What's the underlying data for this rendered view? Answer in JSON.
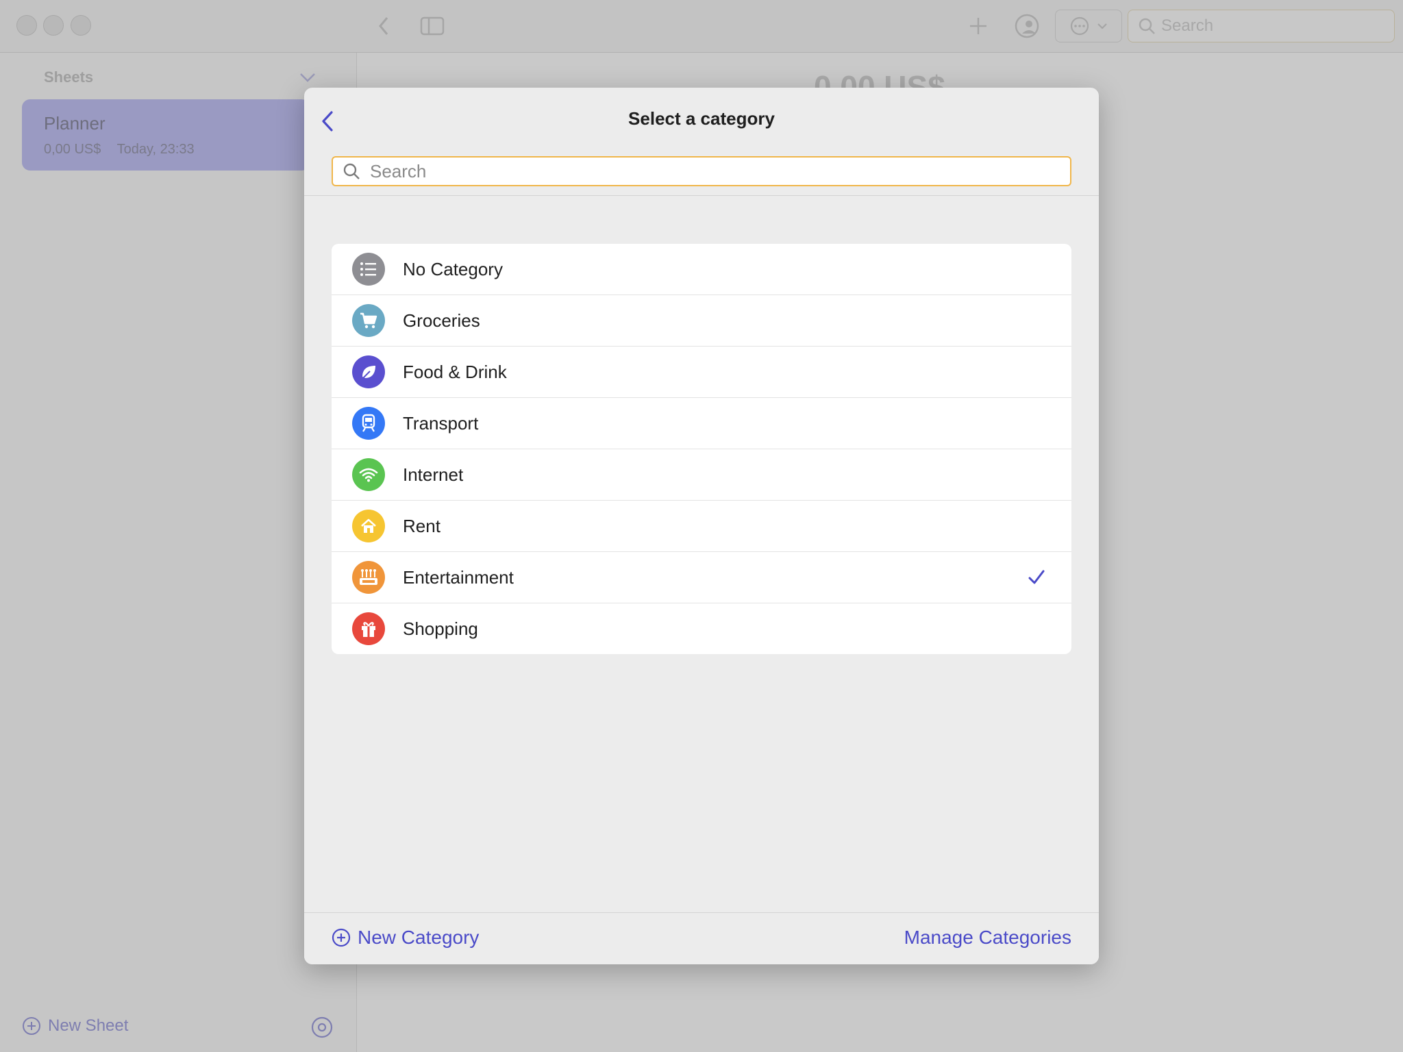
{
  "toolbar": {
    "search_placeholder": "Search"
  },
  "sidebar": {
    "header": "Sheets",
    "sheet": {
      "title": "Planner",
      "amount": "0,00 US$",
      "timestamp": "Today, 23:33"
    },
    "new_sheet_label": "New Sheet"
  },
  "main": {
    "total": "0,00 US$"
  },
  "modal": {
    "title": "Select a category",
    "search_placeholder": "Search",
    "categories": [
      {
        "label": "No Category",
        "icon": "list-icon",
        "color": "#8e8e93"
      },
      {
        "label": "Groceries",
        "icon": "cart-icon",
        "color": "#6aa9c4"
      },
      {
        "label": "Food & Drink",
        "icon": "leaf-icon",
        "color": "#5a4fcf"
      },
      {
        "label": "Transport",
        "icon": "train-icon",
        "color": "#3478f6"
      },
      {
        "label": "Internet",
        "icon": "wifi-icon",
        "color": "#5ac451"
      },
      {
        "label": "Rent",
        "icon": "house-icon",
        "color": "#f6c531"
      },
      {
        "label": "Entertainment",
        "icon": "arcade-icon",
        "color": "#f0953a",
        "selected": true
      },
      {
        "label": "Shopping",
        "icon": "gift-icon",
        "color": "#e8483c"
      }
    ],
    "new_category_label": "New Category",
    "manage_categories_label": "Manage Categories",
    "accent_color": "#4a4ac8"
  }
}
